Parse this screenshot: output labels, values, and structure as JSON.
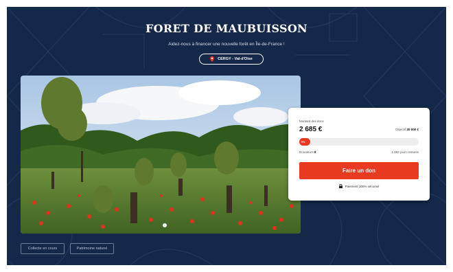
{
  "page": {
    "title": "FORET DE MAUBUISSON",
    "subtitle": "Aidez-nous à financer une nouvelle forêt en Île-de-France !",
    "location": {
      "label": "CERGY - Val-d'Oise",
      "icon": "map-pin-icon"
    }
  },
  "donation": {
    "amount_label": "Montant des dons",
    "amount": "2 685 €",
    "goal_label": "Objectif",
    "goal_value": "30 000 €",
    "progress_label": "9%",
    "progress_fraction": 0.09,
    "donors_label": "Donateurs",
    "donors_count": "8",
    "days_left": "1 092 jours restants",
    "donate_button": "Faire un don",
    "secure_text": "Paiement 100% sécurisé",
    "secure_icon": "lock-icon"
  },
  "tags": [
    "Collecte en cours",
    "Patrimoine naturel"
  ],
  "colors": {
    "background": "#14284a",
    "accent": "#e93a22",
    "card": "#ffffff"
  }
}
